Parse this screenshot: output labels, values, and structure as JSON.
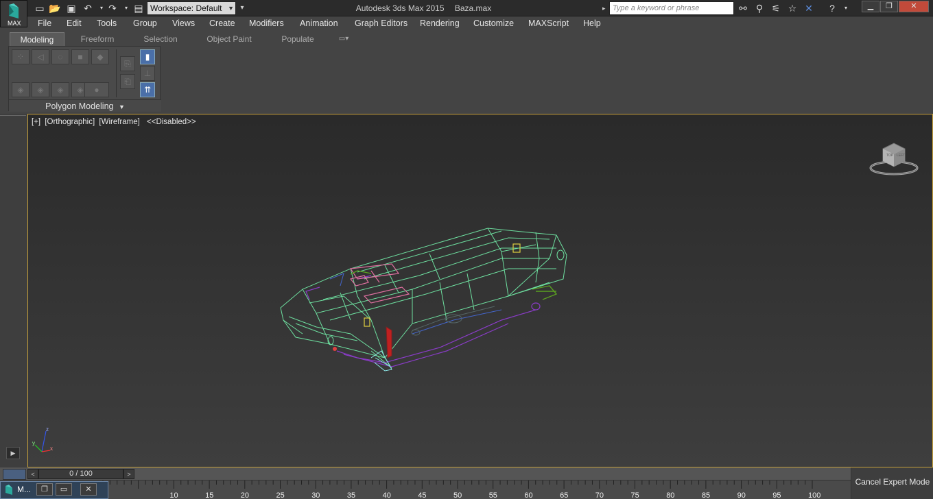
{
  "title_bar": {
    "app_name": "Autodesk 3ds Max  2015",
    "file_name": "Baza.max",
    "logo_text": "MAX",
    "workspace": "Workspace: Default",
    "search_placeholder": "Type a keyword or phrase",
    "quick_access_icons": [
      "new-file-icon",
      "open-folder-icon",
      "save-icon",
      "undo-icon",
      "redo-icon",
      "project-folder-icon"
    ],
    "toolbar_icons": [
      "binoculars-icon",
      "key-tools-icon",
      "satellite-icon",
      "star-icon",
      "x-close-search-icon",
      "help-icon"
    ]
  },
  "menu": {
    "items": [
      "File",
      "Edit",
      "Tools",
      "Group",
      "Views",
      "Create",
      "Modifiers",
      "Animation",
      "Graph Editors",
      "Rendering",
      "Customize",
      "MAXScript",
      "Help"
    ]
  },
  "ribbon": {
    "tabs": [
      "Modeling",
      "Freeform",
      "Selection",
      "Object Paint",
      "Populate"
    ],
    "active_tab": "Modeling",
    "panel_caption": "Polygon Modeling",
    "panel_caption_arrow": "▼"
  },
  "viewport": {
    "label_parts": [
      "[+]",
      "[Orthographic]",
      "[Wireframe]",
      "<<Disabled>>"
    ],
    "viewcube_labels": [
      "TOP",
      "LEFT"
    ],
    "axis_labels": [
      "z",
      "x",
      "y"
    ]
  },
  "timeline": {
    "frame_display": "0 / 100",
    "current_frame": 0,
    "total_frames": 100,
    "ruler_ticks": [
      10,
      15,
      20,
      25,
      30,
      35,
      40,
      45,
      50,
      55,
      60,
      65,
      70,
      75,
      80,
      85,
      90,
      95,
      100
    ]
  },
  "status": {
    "cancel_expert_mode": "Cancel Expert Mode"
  },
  "mini_window": {
    "label": "M..."
  },
  "colors": {
    "viewport_border": "#c8a23c",
    "wire_main": "#6ee0a0",
    "wire_pink": "#e070a0",
    "wire_purple": "#8a3cc8",
    "wire_green": "#5aa020",
    "wire_red": "#c02020",
    "wire_yellow": "#e0d040"
  }
}
